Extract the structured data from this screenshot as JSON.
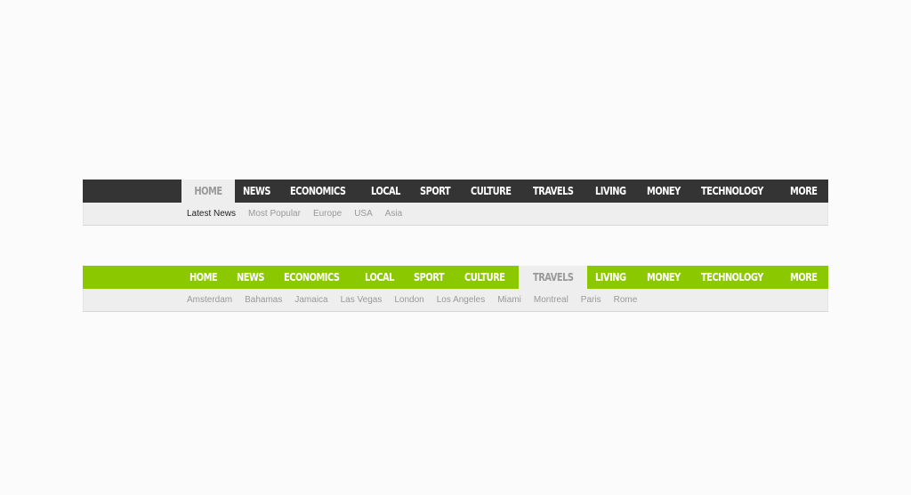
{
  "menus": [
    {
      "theme": "dark",
      "bar_color": "#343434",
      "tabs": [
        {
          "label": "HOME",
          "active": true
        },
        {
          "label": "NEWS",
          "active": false
        },
        {
          "label": "ECONOMICS",
          "active": false
        },
        {
          "label": "LOCAL",
          "active": false
        },
        {
          "label": "SPORT",
          "active": false
        },
        {
          "label": "CULTURE",
          "active": false
        },
        {
          "label": "TRAVELS",
          "active": false
        },
        {
          "label": "LIVING",
          "active": false
        },
        {
          "label": "MONEY",
          "active": false
        },
        {
          "label": "TECHNOLOGY",
          "active": false
        },
        {
          "label": "MORE",
          "active": false
        }
      ],
      "subitems": [
        {
          "label": "Latest News",
          "current": true
        },
        {
          "label": "Most Popular",
          "current": false
        },
        {
          "label": "Europe",
          "current": false
        },
        {
          "label": "USA",
          "current": false
        },
        {
          "label": "Asia",
          "current": false
        }
      ]
    },
    {
      "theme": "green",
      "bar_color": "#8cc800",
      "tabs": [
        {
          "label": "HOME",
          "active": false
        },
        {
          "label": "NEWS",
          "active": false
        },
        {
          "label": "ECONOMICS",
          "active": false
        },
        {
          "label": "LOCAL",
          "active": false
        },
        {
          "label": "SPORT",
          "active": false
        },
        {
          "label": "CULTURE",
          "active": false
        },
        {
          "label": "TRAVELS",
          "active": true
        },
        {
          "label": "LIVING",
          "active": false
        },
        {
          "label": "MONEY",
          "active": false
        },
        {
          "label": "TECHNOLOGY",
          "active": false
        },
        {
          "label": "MORE",
          "active": false
        }
      ],
      "subitems": [
        {
          "label": "Amsterdam",
          "current": false
        },
        {
          "label": "Bahamas",
          "current": false
        },
        {
          "label": "Jamaica",
          "current": false
        },
        {
          "label": "Las Vegas",
          "current": false
        },
        {
          "label": "London",
          "current": false
        },
        {
          "label": "Los Angeles",
          "current": false
        },
        {
          "label": "Miami",
          "current": false
        },
        {
          "label": "Montreal",
          "current": false
        },
        {
          "label": "Paris",
          "current": false
        },
        {
          "label": "Rome",
          "current": false
        }
      ]
    }
  ]
}
